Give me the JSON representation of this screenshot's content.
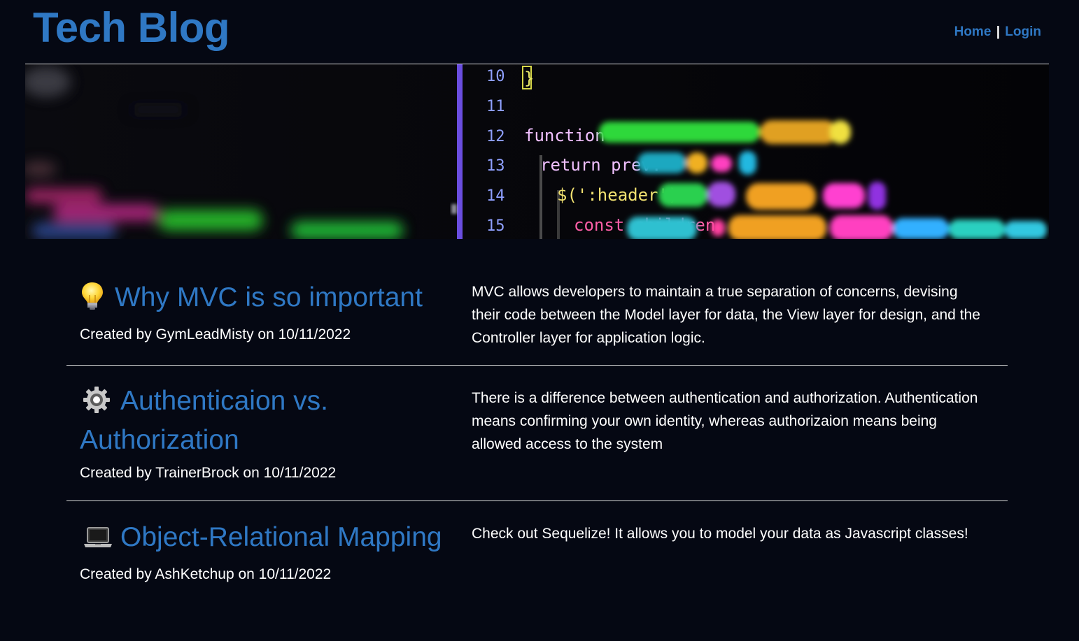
{
  "header": {
    "title": "Tech Blog",
    "nav": {
      "home_label": "Home",
      "separator": "|",
      "login_label": "Login"
    }
  },
  "banner": {
    "code_lines": [
      {
        "number": "10",
        "text": "}"
      },
      {
        "number": "11",
        "text": ""
      },
      {
        "number": "12",
        "text": "function"
      },
      {
        "number": "13",
        "text": "return prev."
      },
      {
        "number": "14",
        "text": "$(':header')."
      },
      {
        "number": "15",
        "text": "const children"
      }
    ]
  },
  "posts": [
    {
      "icon": "lightbulb-icon",
      "title": "Why MVC is so important",
      "meta": "Created by GymLeadMisty on 10/11/2022",
      "body": "MVC allows developers to maintain a true separation of concerns, devising their code between the Model layer for data, the View layer for design, and the Controller layer for application logic."
    },
    {
      "icon": "gear-icon",
      "title": "Authenticaion vs. Authorization",
      "meta": "Created by TrainerBrock on 10/11/2022",
      "body": "There is a difference between authentication and authorization. Authentication means confirming your own identity, whereas authorizaion means being allowed access to the system"
    },
    {
      "icon": "laptop-icon",
      "title": "Object-Relational Mapping",
      "meta": "Created by AshKetchup on 10/11/2022",
      "body": "Check out Sequelize! It allows you to model your data as Javascript classes!"
    }
  ],
  "colors": {
    "background": "#050813",
    "accent": "#2f78c4",
    "text": "#ffffff",
    "divider": "#d9d9d9"
  }
}
